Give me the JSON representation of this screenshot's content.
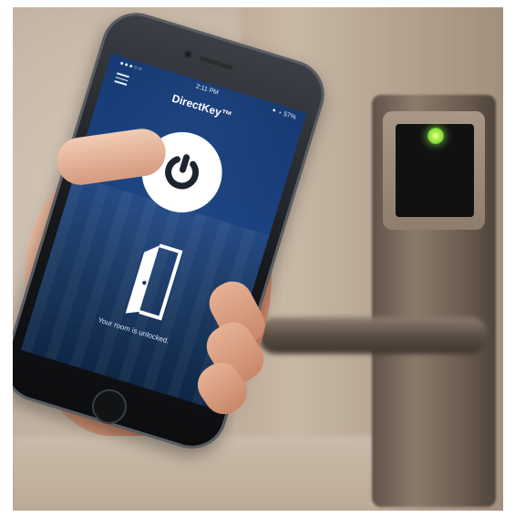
{
  "phone": {
    "status_time": "2:11 PM",
    "status_right": "✦ ⋆ 57%",
    "app_title": "DirectKey™",
    "message": "Your room is unlocked."
  },
  "icons": {
    "menu": "hamburger-menu-icon",
    "power": "power-icon",
    "door": "open-door-icon"
  },
  "colors": {
    "screen_blue": "#1a4280",
    "led_green": "#8ce33a"
  }
}
